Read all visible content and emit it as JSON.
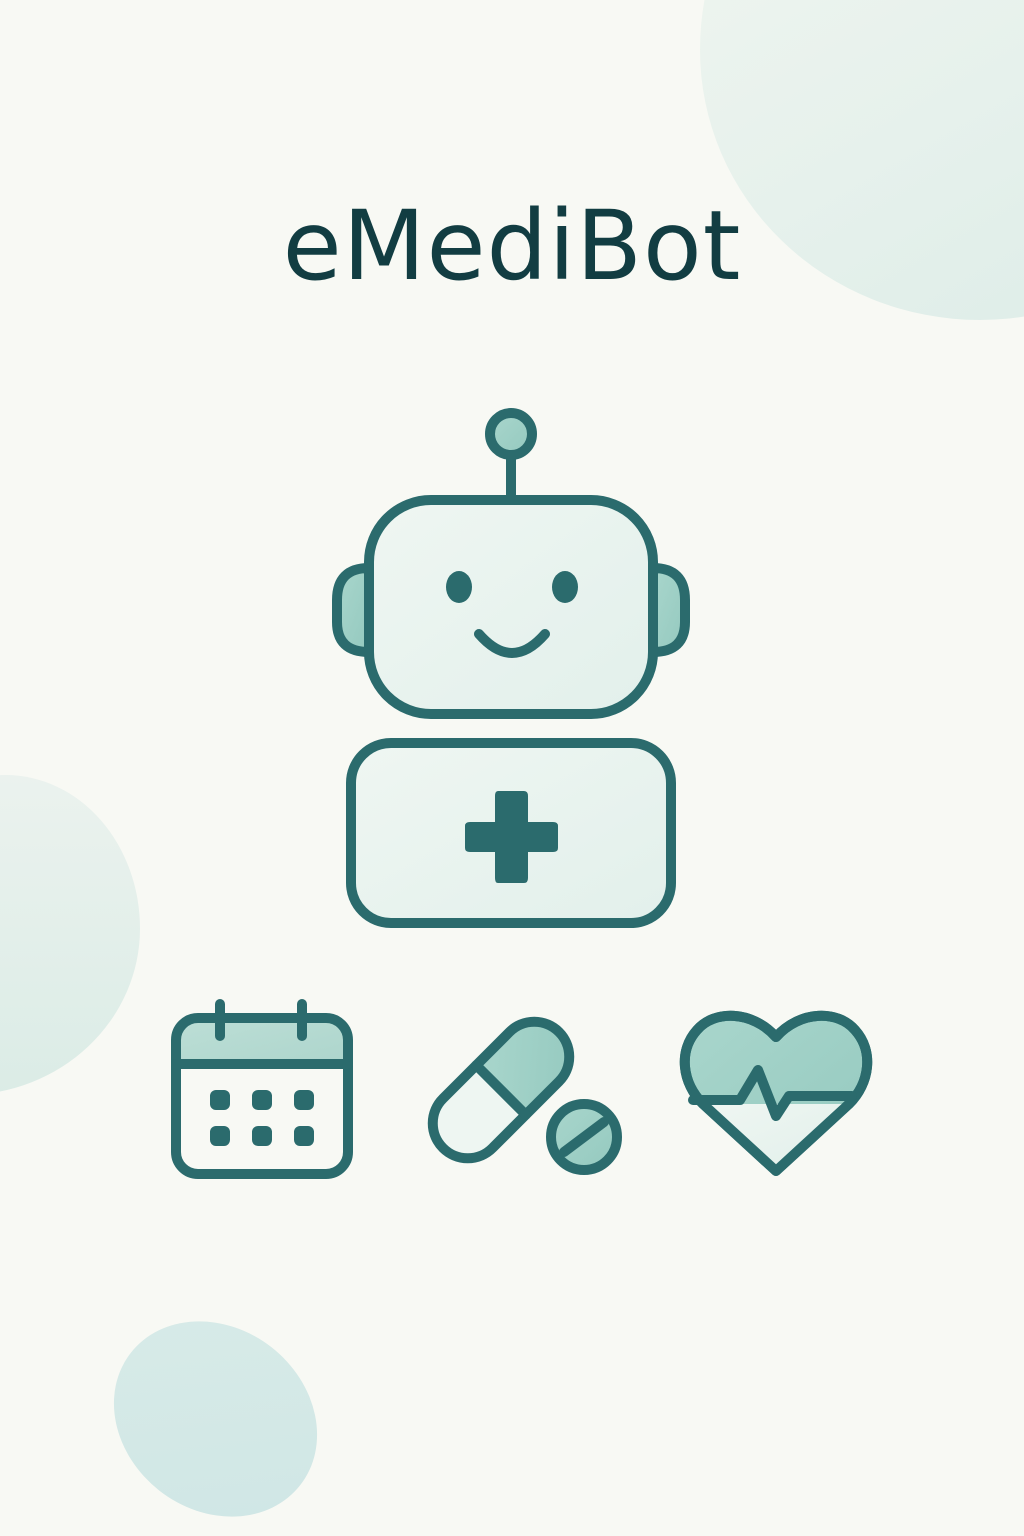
{
  "app": {
    "title": "eMediBot"
  },
  "illustration": {
    "main_icon": "medical-robot-icon",
    "feature_icons": [
      "calendar-icon",
      "pill-icon",
      "heart-pulse-icon"
    ]
  },
  "colors": {
    "background": "#f8f9f4",
    "title_text": "#123d42",
    "outline": "#2b6b6d",
    "fill_light": "#e7f2ee",
    "fill_accent": "#a3d1c8",
    "blob": "#dbece6"
  }
}
